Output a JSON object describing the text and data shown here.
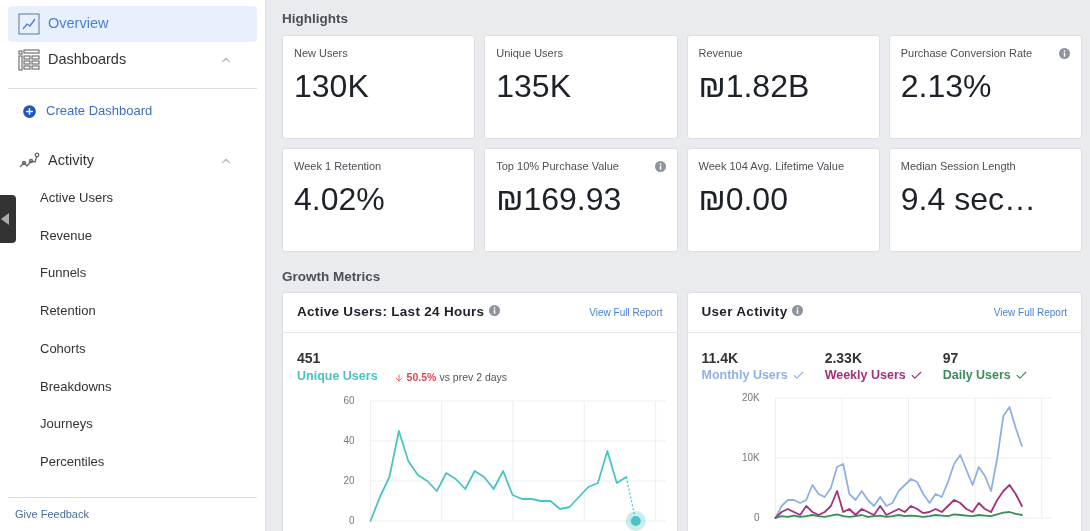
{
  "sidebar": {
    "items": [
      {
        "label": "Overview",
        "selected": true
      },
      {
        "label": "Dashboards",
        "selected": false,
        "expanded": true,
        "children": [
          {
            "label": "Create Dashboard",
            "kind": "action",
            "selected": false
          }
        ]
      },
      {
        "label": "Activity",
        "selected": false,
        "expanded": true,
        "children": [
          {
            "label": "Active Users",
            "kind": "link",
            "selected": false
          },
          {
            "label": "Revenue",
            "kind": "link",
            "selected": false
          },
          {
            "label": "Funnels",
            "kind": "link",
            "selected": false
          },
          {
            "label": "Retention",
            "kind": "link",
            "selected": false
          },
          {
            "label": "Cohorts",
            "kind": "link",
            "selected": false
          },
          {
            "label": "Breakdowns",
            "kind": "link",
            "selected": false
          },
          {
            "label": "Journeys",
            "kind": "link",
            "selected": false
          },
          {
            "label": "Percentiles",
            "kind": "link",
            "selected": false
          }
        ]
      }
    ],
    "footer": "Give Feedback"
  },
  "highlights": {
    "title": "Highlights",
    "cards": [
      {
        "label": "New Users",
        "value": "130K",
        "info": false
      },
      {
        "label": "Unique Users",
        "value": "135K",
        "info": false
      },
      {
        "label": "Revenue",
        "value": "₪1.82B",
        "info": false
      },
      {
        "label": "Purchase Conversion Rate",
        "value": "2.13%",
        "info": true
      },
      {
        "label": "Week 1 Retention",
        "value": "4.02%",
        "info": false
      },
      {
        "label": "Top 10% Purchase Value",
        "value": "₪169.93",
        "info": true
      },
      {
        "label": "Week 104 Avg. Lifetime Value",
        "value": "₪0.00",
        "info": false
      },
      {
        "label": "Median Session Length",
        "value": "9.4 sec…",
        "info": false
      }
    ]
  },
  "growth_metrics": {
    "title": "Growth Metrics",
    "panels": [
      {
        "title": "Active Users: Last 24 Hours",
        "link": "View Full Report",
        "stats": [
          {
            "value": "451",
            "label": "Unique Users",
            "color": "#4cc3c3"
          }
        ],
        "delta": {
          "value": "50.5%",
          "text": "vs prev 2 days"
        },
        "chart_data": {
          "type": "line",
          "grid": true,
          "yticks": [
            0,
            20,
            40,
            60
          ],
          "ylim": [
            0,
            60
          ],
          "series": [
            {
              "color": "#4cc3c3",
              "values": [
                0,
                12,
                22,
                45,
                30,
                23,
                20,
                15,
                24,
                21,
                16,
                25,
                22,
                16,
                25,
                13,
                11,
                11,
                10,
                10,
                6,
                7,
                12,
                17,
                19,
                35,
                19,
                22
              ]
            }
          ]
        }
      },
      {
        "title": "User Activity",
        "link": "View Full Report",
        "stats": [
          {
            "value": "11.4K",
            "label": "Monthly Users",
            "color": "#8fb0e6",
            "checked": true
          },
          {
            "value": "2.33K",
            "label": "Weekly Users",
            "color": "#a3317a",
            "checked": true
          },
          {
            "value": "97",
            "label": "Daily Users",
            "color": "#3d8a5a",
            "checked": true
          }
        ],
        "chart_data": {
          "type": "line",
          "grid": true,
          "yticks": [
            {
              "value": 0,
              "label": "0"
            },
            {
              "value": 10000,
              "label": "10K"
            },
            {
              "value": 20000,
              "label": "20K"
            }
          ],
          "ylim": [
            0,
            20000
          ],
          "series": [
            {
              "color": "#8fb0e6",
              "values": [
                0,
                2000,
                3000,
                3000,
                2500,
                3000,
                5500,
                4000,
                3500,
                5000,
                8500,
                9000,
                4000,
                3000,
                4500,
                3000,
                2000,
                3500,
                2000,
                2500,
                4500,
                5500,
                6500,
                6000,
                4000,
                2500,
                4000,
                3500,
                6000,
                9000,
                10500,
                8000,
                5500,
                8500,
                7000,
                4500,
                10000,
                17000,
                18500,
                15000,
                12000
              ]
            },
            {
              "color": "#a3317a",
              "values": [
                0,
                1000,
                1500,
                1000,
                500,
                2000,
                1000,
                500,
                1000,
                2000,
                4500,
                1000,
                1500,
                500,
                1500,
                1000,
                500,
                2000,
                500,
                1000,
                1500,
                1000,
                2000,
                1500,
                800,
                1000,
                1500,
                1000,
                2000,
                3000,
                2500,
                1500,
                1000,
                2500,
                1500,
                1000,
                3000,
                4500,
                5500,
                4000,
                2000
              ]
            },
            {
              "color": "#3d8a5a",
              "values": [
                0,
                300,
                200,
                400,
                200,
                300,
                500,
                300,
                200,
                400,
                600,
                300,
                200,
                300,
                500,
                200,
                300,
                400,
                200,
                300,
                500,
                300,
                400,
                300,
                200,
                300,
                500,
                400,
                300,
                600,
                500,
                400,
                300,
                500,
                400,
                300,
                600,
                900,
                1000,
                700,
                500
              ]
            }
          ]
        }
      }
    ]
  }
}
